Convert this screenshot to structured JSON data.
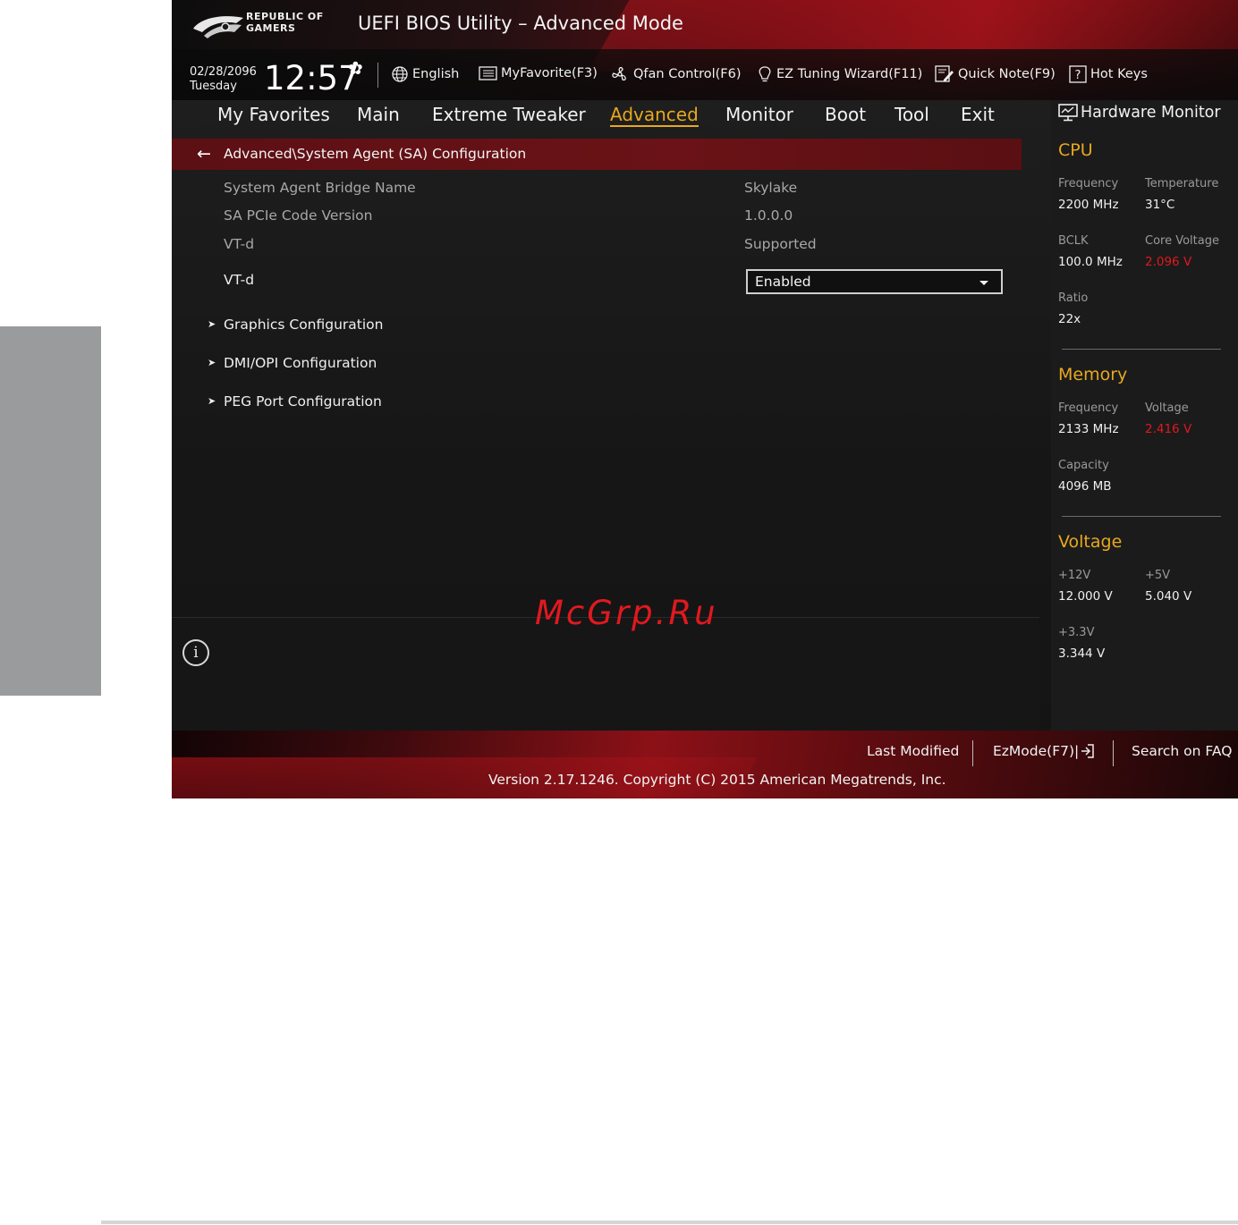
{
  "header": {
    "logo_text_line1": "REPUBLIC OF",
    "logo_text_line2": "GAMERS",
    "title": "UEFI BIOS Utility – Advanced Mode"
  },
  "status": {
    "date": "02/28/2096",
    "day": "Tuesday",
    "time": "12:57",
    "tools": {
      "language": "English",
      "favorite": "MyFavorite(F3)",
      "qfan": "Qfan Control(F6)",
      "ez_tuning": "EZ Tuning Wizard(F11)",
      "quick_note": "Quick Note(F9)",
      "hot_keys": "Hot Keys"
    }
  },
  "menu": {
    "items": [
      "My Favorites",
      "Main",
      "Extreme Tweaker",
      "Advanced",
      "Monitor",
      "Boot",
      "Tool",
      "Exit"
    ],
    "active": "Advanced"
  },
  "breadcrumb": "Advanced\\System Agent (SA) Configuration",
  "settings": [
    {
      "label": "System Agent Bridge Name",
      "value": "Skylake"
    },
    {
      "label": "SA PCIe Code Version",
      "value": "1.0.0.0"
    },
    {
      "label": "VT-d",
      "value": "Supported"
    }
  ],
  "vtd_option": {
    "label": "VT-d",
    "selected": "Enabled"
  },
  "submenus": [
    "Graphics Configuration",
    "DMI/OPI Configuration",
    "PEG Port Configuration"
  ],
  "watermark": "McGrp.Ru",
  "hardware_monitor": {
    "title": "Hardware Monitor",
    "cpu": {
      "heading": "CPU",
      "frequency_label": "Frequency",
      "frequency": "2200 MHz",
      "temperature_label": "Temperature",
      "temperature": "31°C",
      "bclk_label": "BCLK",
      "bclk": "100.0 MHz",
      "core_voltage_label": "Core Voltage",
      "core_voltage": "2.096 V",
      "ratio_label": "Ratio",
      "ratio": "22x"
    },
    "memory": {
      "heading": "Memory",
      "frequency_label": "Frequency",
      "frequency": "2133 MHz",
      "voltage_label": "Voltage",
      "voltage": "2.416 V",
      "capacity_label": "Capacity",
      "capacity": "4096 MB"
    },
    "voltage": {
      "heading": "Voltage",
      "v12_label": "+12V",
      "v12": "12.000 V",
      "v5_label": "+5V",
      "v5": "5.040 V",
      "v33_label": "+3.3V",
      "v33": "3.344 V"
    }
  },
  "footer": {
    "last_modified": "Last Modified",
    "ezmode": "EzMode(F7)|",
    "search_faq": "Search on FAQ",
    "version": "Version 2.17.1246. Copyright (C) 2015 American Megatrends, Inc."
  },
  "colors": {
    "accent": "#e8a81f",
    "warning_red": "#e0191f",
    "breadcrumb_bg": "#5c1014"
  }
}
